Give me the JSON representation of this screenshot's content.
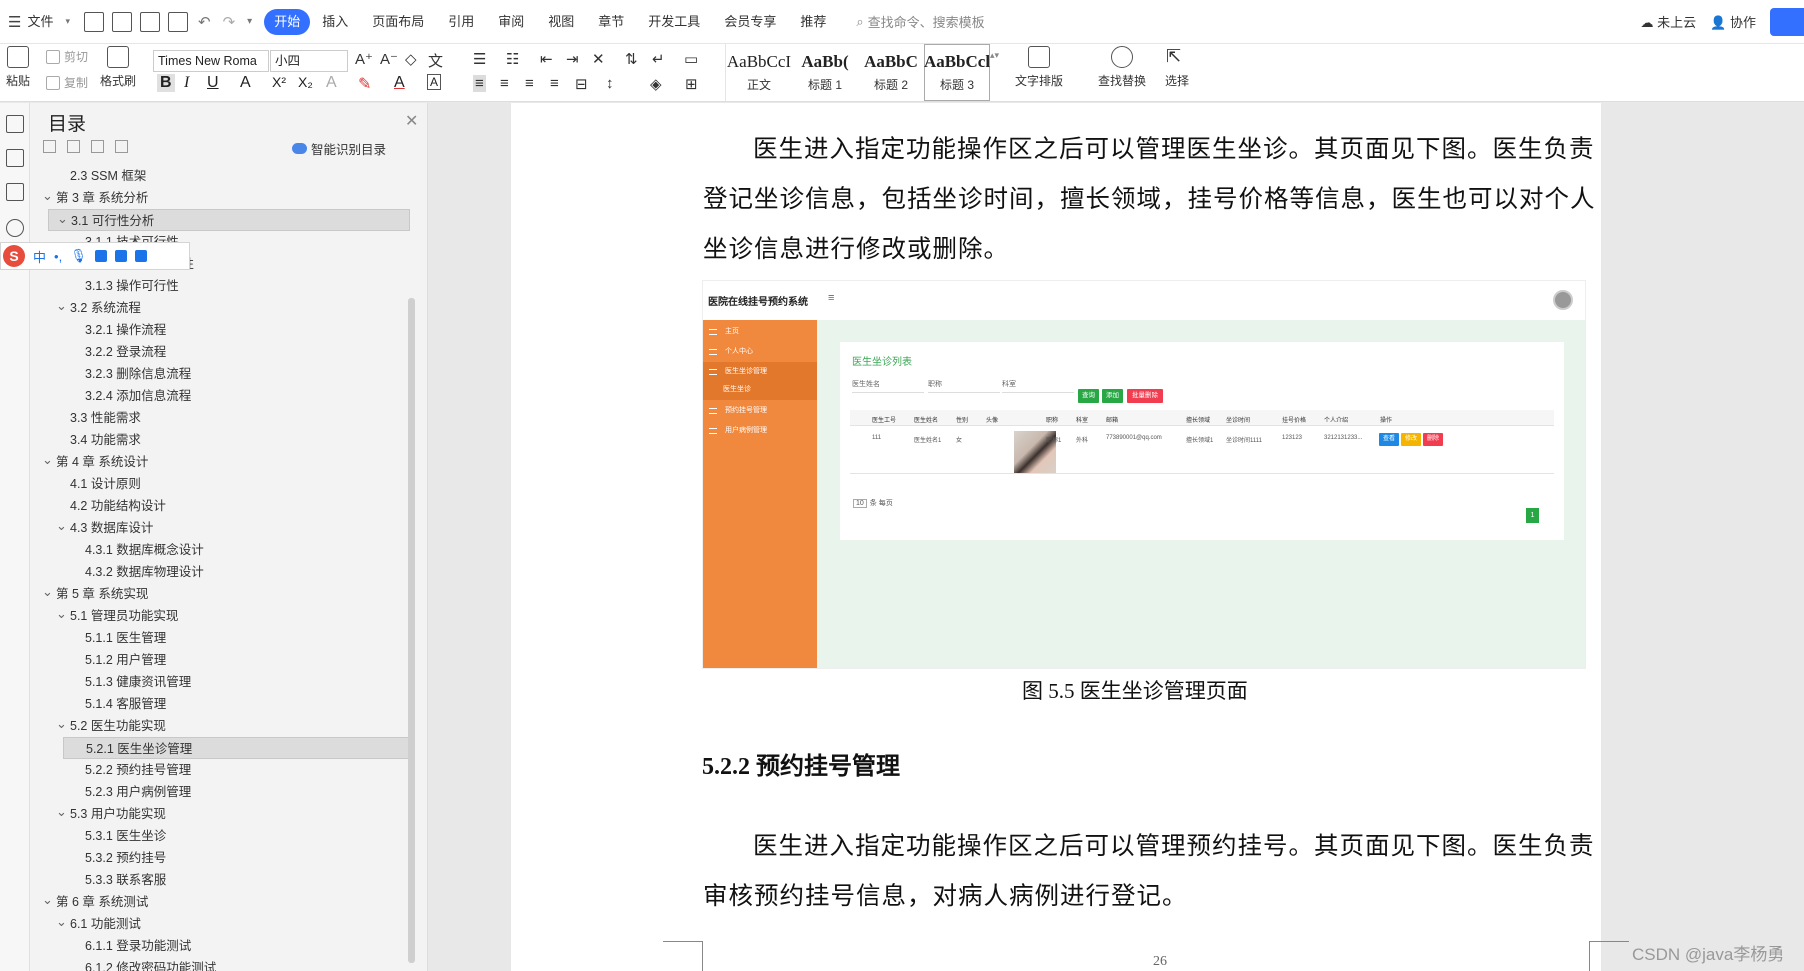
{
  "menubar": {
    "file": "文件",
    "tabs": [
      "开始",
      "插入",
      "页面布局",
      "引用",
      "审阅",
      "视图",
      "章节",
      "开发工具",
      "会员专享",
      "推荐"
    ],
    "active_tab": "开始",
    "search_placeholder": "查找命令、搜索模板",
    "cloud": "未上云",
    "collab": "协作"
  },
  "ribbon": {
    "paste": "粘贴",
    "cut": "剪切",
    "copy": "复制",
    "format_painter": "格式刷",
    "font_name": "Times New Roma",
    "font_size": "小四",
    "styles": [
      {
        "sample": "AaBbCcI",
        "label": "正文"
      },
      {
        "sample": "AaBb(",
        "label": "标题 1"
      },
      {
        "sample": "AaBbC",
        "label": "标题 2"
      },
      {
        "sample": "AaBbCcl",
        "label": "标题 3"
      }
    ],
    "text_layout": "文字排版",
    "find_replace": "查找替换",
    "select": "选择"
  },
  "toc": {
    "title": "目录",
    "smart": "智能识别目录",
    "items": [
      {
        "text": "2.3 SSM 框架",
        "level": 2,
        "chev": false
      },
      {
        "text": "第 3 章  系统分析",
        "level": 1,
        "chev": true
      },
      {
        "text": "3.1  可行性分析",
        "level": 2,
        "chev": true,
        "selected": true
      },
      {
        "text": "3.1.1  技术可行性",
        "level": 3,
        "chev": false
      },
      {
        "text": "行性",
        "level": 3,
        "chev": false
      },
      {
        "text": "3.1.3  操作可行性",
        "level": 3,
        "chev": false
      },
      {
        "text": "3.2  系统流程",
        "level": 2,
        "chev": true
      },
      {
        "text": "3.2.1  操作流程",
        "level": 3,
        "chev": false
      },
      {
        "text": "3.2.2  登录流程",
        "level": 3,
        "chev": false
      },
      {
        "text": "3.2.3  删除信息流程",
        "level": 3,
        "chev": false
      },
      {
        "text": "3.2.4  添加信息流程",
        "level": 3,
        "chev": false
      },
      {
        "text": "3.3  性能需求",
        "level": 2,
        "chev": false
      },
      {
        "text": "3.4  功能需求",
        "level": 2,
        "chev": false
      },
      {
        "text": "第 4 章  系统设计",
        "level": 1,
        "chev": true
      },
      {
        "text": "4.1  设计原则",
        "level": 2,
        "chev": false
      },
      {
        "text": "4.2  功能结构设计",
        "level": 2,
        "chev": false
      },
      {
        "text": "4.3  数据库设计",
        "level": 2,
        "chev": true
      },
      {
        "text": "4.3.1  数据库概念设计",
        "level": 3,
        "chev": false
      },
      {
        "text": "4.3.2  数据库物理设计",
        "level": 3,
        "chev": false
      },
      {
        "text": "第 5 章  系统实现",
        "level": 1,
        "chev": true
      },
      {
        "text": "5.1  管理员功能实现",
        "level": 2,
        "chev": true
      },
      {
        "text": "5.1.1  医生管理",
        "level": 3,
        "chev": false
      },
      {
        "text": "5.1.2  用户管理",
        "level": 3,
        "chev": false
      },
      {
        "text": "5.1.3  健康资讯管理",
        "level": 3,
        "chev": false
      },
      {
        "text": "5.1.4  客服管理",
        "level": 3,
        "chev": false
      },
      {
        "text": "5.2  医生功能实现",
        "level": 2,
        "chev": true
      },
      {
        "text": "5.2.1  医生坐诊管理",
        "level": 3,
        "chev": false,
        "selected": true
      },
      {
        "text": "5.2.2  预约挂号管理",
        "level": 3,
        "chev": false
      },
      {
        "text": "5.2.3  用户病例管理",
        "level": 3,
        "chev": false
      },
      {
        "text": "5.3  用户功能实现",
        "level": 2,
        "chev": true
      },
      {
        "text": "5.3.1  医生坐诊",
        "level": 3,
        "chev": false
      },
      {
        "text": "5.3.2  预约挂号",
        "level": 3,
        "chev": false
      },
      {
        "text": "5.3.3  联系客服",
        "level": 3,
        "chev": false
      },
      {
        "text": "第 6 章  系统测试",
        "level": 1,
        "chev": true
      },
      {
        "text": "6.1  功能测试",
        "level": 2,
        "chev": true
      },
      {
        "text": "6.1.1  登录功能测试",
        "level": 3,
        "chev": false
      },
      {
        "text": "6.1.2  修改密码功能测试",
        "level": 3,
        "chev": false
      }
    ]
  },
  "ime": {
    "lang": "中",
    "punct": "•,"
  },
  "doc": {
    "para1": [
      "医生进入指定功能操作区之后可以管理医生坐诊。其页面见下图。医生负责",
      "登记坐诊信息，包括坐诊时间，擅长领域，挂号价格等信息，医生也可以对个人",
      "坐诊信息进行修改或删除。"
    ],
    "caption": "图 5.5  医生坐诊管理页面",
    "heading": "5.2.2  预约挂号管理",
    "para2": [
      "医生进入指定功能操作区之后可以管理预约挂号。其页面见下图。医生负责",
      "审核预约挂号信息，对病人病例进行登记。"
    ],
    "page_number": "26",
    "watermark": "CSDN @java李杨勇"
  },
  "screenshot": {
    "app_title": "医院在线挂号预约系统",
    "sidebar": [
      "主页",
      "个人中心",
      "医生坐诊管理",
      "医生坐诊",
      "预约挂号管理",
      "用户病例管理"
    ],
    "list_title": "医生坐诊列表",
    "filters": [
      "医生姓名",
      "职称",
      "科室"
    ],
    "buttons": {
      "search": "查询",
      "add": "添加",
      "batch_delete": "批量删除"
    },
    "columns": [
      "医生工号",
      "医生姓名",
      "性别",
      "头像",
      "职称",
      "科室",
      "邮箱",
      "擅长领域",
      "坐诊时间",
      "挂号价格",
      "个人介绍",
      "操作"
    ],
    "row": [
      "111",
      "医生姓名1",
      "女",
      "",
      "职称1",
      "外科",
      "773890001@qq.com",
      "擅长领域1",
      "坐诊时间1111",
      "123123",
      "3212131233..."
    ],
    "row_actions": {
      "view": "查看",
      "edit": "修改",
      "delete": "删除"
    },
    "page_size": "10",
    "per_page": "条 每页",
    "page": "1",
    "colors": {
      "sidebar": "#f0883e",
      "green": "#28a745",
      "red": "#f23c50",
      "blue": "#1e88e5",
      "yellow": "#f5b400"
    }
  }
}
